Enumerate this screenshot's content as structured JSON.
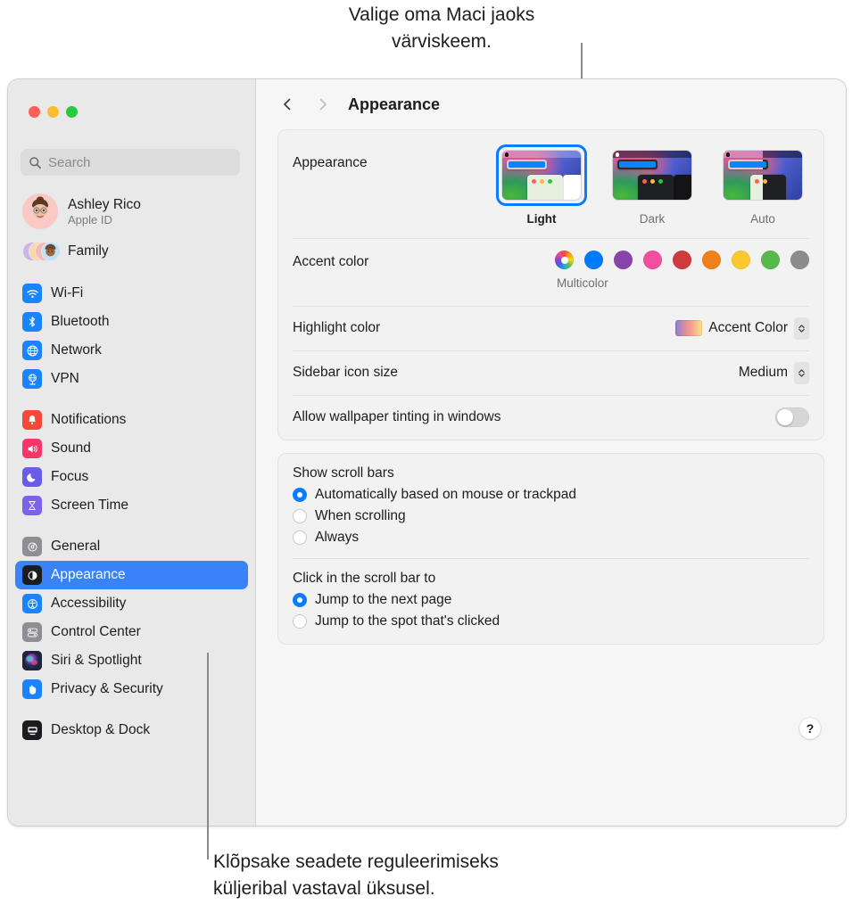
{
  "callouts": {
    "top": "Valige oma Maci jaoks\nvärviskeem.",
    "bottom": "Klõpsake seadete reguleerimiseks\nküljeribal vastaval üksusel."
  },
  "window": {
    "toolbar": {
      "back_icon": "chevron-left-icon",
      "forward_icon": "chevron-right-icon",
      "title": "Appearance"
    },
    "traffic_lights": [
      "close",
      "minimize",
      "zoom"
    ]
  },
  "sidebar": {
    "search": {
      "placeholder": "Search",
      "value": "",
      "icon": "search-icon"
    },
    "profile": {
      "name": "Ashley Rico",
      "subtitle": "Apple ID",
      "avatar": "memoji-avatar"
    },
    "family": {
      "label": "Family",
      "icon": "family-avatars-icon"
    },
    "groups": [
      {
        "items": [
          {
            "label": "Wi-Fi",
            "icon": "wifi-icon",
            "color": "#1a84ff",
            "selected": false
          },
          {
            "label": "Bluetooth",
            "icon": "bluetooth-icon",
            "color": "#1a84ff",
            "selected": false
          },
          {
            "label": "Network",
            "icon": "globe-icon",
            "color": "#1a84ff",
            "selected": false
          },
          {
            "label": "VPN",
            "icon": "vpn-globe-icon",
            "color": "#1a84ff",
            "selected": false
          }
        ]
      },
      {
        "items": [
          {
            "label": "Notifications",
            "icon": "bell-icon",
            "color": "#f5483b",
            "selected": false
          },
          {
            "label": "Sound",
            "icon": "speaker-icon",
            "color": "#f4366b",
            "selected": false
          },
          {
            "label": "Focus",
            "icon": "moon-icon",
            "color": "#6b5ce7",
            "selected": false
          },
          {
            "label": "Screen Time",
            "icon": "hourglass-icon",
            "color": "#7a63e8",
            "selected": false
          }
        ]
      },
      {
        "items": [
          {
            "label": "General",
            "icon": "gear-icon",
            "color": "#8e8e93",
            "selected": false
          },
          {
            "label": "Appearance",
            "icon": "appearance-contrast-icon",
            "color": "#1c1c1e",
            "selected": true
          },
          {
            "label": "Accessibility",
            "icon": "accessibility-icon",
            "color": "#1a84ff",
            "selected": false
          },
          {
            "label": "Control Center",
            "icon": "control-center-icon",
            "color": "#8e8e93",
            "selected": false
          },
          {
            "label": "Siri & Spotlight",
            "icon": "siri-icon",
            "color": "#2b2b40",
            "selected": false
          },
          {
            "label": "Privacy & Security",
            "icon": "hand-icon",
            "color": "#1a84ff",
            "selected": false
          }
        ]
      },
      {
        "items": [
          {
            "label": "Desktop & Dock",
            "icon": "desktop-dock-icon",
            "color": "#1c1c1e",
            "selected": false
          }
        ]
      }
    ]
  },
  "main": {
    "appearance": {
      "label": "Appearance",
      "options": [
        {
          "name": "Light",
          "selected": true
        },
        {
          "name": "Dark",
          "selected": false
        },
        {
          "name": "Auto",
          "selected": false
        }
      ]
    },
    "accent_color": {
      "label": "Accent color",
      "caption": "Multicolor",
      "swatches": [
        {
          "name": "Multicolor",
          "color": "multicolor",
          "selected": true
        },
        {
          "name": "Blue",
          "color": "#007AFF",
          "selected": false
        },
        {
          "name": "Purple",
          "color": "#8944AB",
          "selected": false
        },
        {
          "name": "Pink",
          "color": "#F2509E",
          "selected": false
        },
        {
          "name": "Red",
          "color": "#D0393E",
          "selected": false
        },
        {
          "name": "Orange",
          "color": "#F0811A",
          "selected": false
        },
        {
          "name": "Yellow",
          "color": "#FDC82F",
          "selected": false
        },
        {
          "name": "Green",
          "color": "#57B84B",
          "selected": false
        },
        {
          "name": "Graphite",
          "color": "#8C8C8C",
          "selected": false
        }
      ]
    },
    "highlight_color": {
      "label": "Highlight color",
      "value": "Accent Color"
    },
    "sidebar_icon_size": {
      "label": "Sidebar icon size",
      "value": "Medium"
    },
    "wallpaper_tinting": {
      "label": "Allow wallpaper tinting in windows",
      "enabled": false
    },
    "show_scroll_bars": {
      "title": "Show scroll bars",
      "options": [
        {
          "label": "Automatically based on mouse or trackpad",
          "selected": true
        },
        {
          "label": "When scrolling",
          "selected": false
        },
        {
          "label": "Always",
          "selected": false
        }
      ]
    },
    "click_scroll_bar": {
      "title": "Click in the scroll bar to",
      "options": [
        {
          "label": "Jump to the next page",
          "selected": true
        },
        {
          "label": "Jump to the spot that's clicked",
          "selected": false
        }
      ]
    },
    "help": {
      "label": "?"
    }
  }
}
